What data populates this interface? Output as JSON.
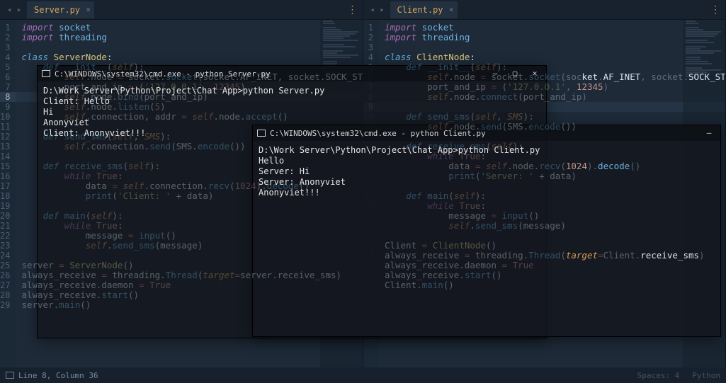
{
  "left": {
    "tab": "Server.py",
    "lines": [
      {
        "n": 1,
        "html": "<span class='kw'>import</span> <span class='fn'>socket</span>"
      },
      {
        "n": 2,
        "html": "<span class='kw'>import</span> <span class='fn'>threading</span>"
      },
      {
        "n": 3,
        "html": ""
      },
      {
        "n": 4,
        "html": "<span class='kw2'>class</span> <span class='cls'>ServerNode</span>:"
      },
      {
        "n": 5,
        "html": "    <span class='kw2 dim'>def</span> <span class='fn dim'>__init__</span><span class='dim'>(</span><span class='self dim'>self</span><span class='dim'>):</span>"
      },
      {
        "n": 6,
        "html": "        <span class='self dim'>self</span><span class='dim'>.node </span><span class='op dim'>=</span><span class='dim'> socket.</span><span class='fn dim'>socket</span><span class='dim'>(socket.AF_INET, socket.SOCK_STREA</span>"
      },
      {
        "n": 7,
        "html": "        <span class='dim'>port_and_ip </span><span class='op dim'>=</span><span class='dim'> (</span><span class='str dim'>'127.0.0.1'</span><span class='dim'>, </span><span class='num dim'>12345</span><span class='dim'>)</span>"
      },
      {
        "n": 8,
        "hl": true,
        "html": "        <span class='self dim'>self</span><span class='dim'>.node.</span><span class='fn dim'>bind</span><span class='dim'>(port_and_ip)</span>"
      },
      {
        "n": 9,
        "html": "        <span class='self dim'>self</span><span class='dim'>.node.</span><span class='fn dim'>listen</span><span class='dim'>(</span><span class='num dim'>5</span><span class='dim'>)</span>"
      },
      {
        "n": 10,
        "html": "        <span class='self dim'>self</span><span class='dim'>.connection, addr </span><span class='op dim'>=</span><span class='dim'> </span><span class='self dim'>self</span><span class='dim'>.node.</span><span class='fn dim'>accept</span><span class='dim'>()</span>"
      },
      {
        "n": 11,
        "html": ""
      },
      {
        "n": 12,
        "html": "    <span class='kw2 dim'>def</span> <span class='fn dim'>send_sms</span><span class='dim'>(</span><span class='self dim'>self</span><span class='dim'>, </span><span class='param dim'>SMS</span><span class='dim'>):</span>"
      },
      {
        "n": 13,
        "html": "        <span class='self dim'>self</span><span class='dim'>.connection.</span><span class='fn dim'>send</span><span class='dim'>(SMS.</span><span class='fn dim'>encode</span><span class='dim'>())</span>"
      },
      {
        "n": 14,
        "html": ""
      },
      {
        "n": 15,
        "html": "    <span class='kw2 dim'>def</span> <span class='fn dim'>receive_sms</span><span class='dim'>(</span><span class='self dim'>self</span><span class='dim'>):</span>"
      },
      {
        "n": 16,
        "html": "        <span class='kw dim'>while</span> <span class='num dim'>True</span><span class='dim'>:</span>"
      },
      {
        "n": 17,
        "html": "            <span class='dim'>data </span><span class='op dim'>=</span><span class='dim'> </span><span class='self dim'>self</span><span class='dim'>.connection.</span><span class='fn dim'>recv</span><span class='dim'>(</span><span class='num dim'>1024</span><span class='dim'>).</span><span class='fn dim'>decode</span><span class='dim'>()</span>"
      },
      {
        "n": 18,
        "html": "            <span class='fn dim'>print</span><span class='dim'>(</span><span class='str dim'>'Client: '</span><span class='dim'> + data)</span>"
      },
      {
        "n": 19,
        "html": ""
      },
      {
        "n": 20,
        "html": "    <span class='kw2 dim'>def</span> <span class='fn dim'>main</span><span class='dim'>(</span><span class='self dim'>self</span><span class='dim'>):</span>"
      },
      {
        "n": 21,
        "html": "        <span class='kw dim'>while</span> <span class='num dim'>True</span><span class='dim'>:</span>"
      },
      {
        "n": 22,
        "html": "            <span class='dim'>message </span><span class='op dim'>=</span><span class='dim'> </span><span class='fn dim'>input</span><span class='dim'>()</span>"
      },
      {
        "n": 23,
        "html": "            <span class='self dim'>self</span><span class='dim'>.</span><span class='fn dim'>send_sms</span><span class='dim'>(message)</span>"
      },
      {
        "n": 24,
        "html": ""
      },
      {
        "n": 25,
        "html": "<span class='dim'>server </span><span class='op dim'>=</span><span class='dim'> </span><span class='cls dim'>ServerNode</span><span class='dim'>()</span>"
      },
      {
        "n": 26,
        "html": "<span class='dim'>always_receive </span><span class='op dim'>=</span><span class='dim'> threading.</span><span class='fn dim'>Thread</span><span class='dim'>(</span><span class='param dim'>target</span><span class='op dim'>=</span><span class='dim'>server.receive_sms)</span>"
      },
      {
        "n": 27,
        "html": "<span class='dim'>always_receive.daemon </span><span class='op dim'>=</span><span class='dim'> </span><span class='num dim'>True</span>"
      },
      {
        "n": 28,
        "html": "<span class='dim'>always_receive.</span><span class='fn dim'>start</span><span class='dim'>()</span>"
      },
      {
        "n": 29,
        "html": "<span class='dim'>server.</span><span class='fn dim'>main</span><span class='dim'>()</span>"
      }
    ]
  },
  "right": {
    "tab": "Client.py",
    "lines": [
      {
        "n": 1,
        "html": "<span class='kw'>import</span> <span class='fn'>socket</span>"
      },
      {
        "n": 2,
        "html": "<span class='kw'>import</span> <span class='fn'>threading</span>"
      },
      {
        "n": 3,
        "html": ""
      },
      {
        "n": 4,
        "html": "<span class='kw2'>class</span> <span class='cls'>ClientNode</span>:"
      },
      {
        "n": 5,
        "html": "    <span class='kw2 dim'>def</span> <span class='fn dim'>__init__</span><span class='dim'>(</span><span class='self dim'>self</span><span class='dim'>):</span>"
      },
      {
        "n": 6,
        "html": "        <span class='self dim'>self</span><span class='dim'>.node </span><span class='op dim'>=</span><span class='dim'> socket.</span><span class='fn dim'>socket</span><span class='dim'>(soc</span>ket<span class='dim'>.</span>AF_INET<span class='dim'>, socket.</span>SOCK_STREA"
      },
      {
        "n": 7,
        "html": "        <span class='dim'>port_and_ip </span><span class='op dim'>=</span><span class='dim'> (</span><span class='str dim'>'127.0.0.1'</span><span class='dim'>, </span><span class='num'>12345</span><span class='dim'>)</span>"
      },
      {
        "n": 8,
        "html": "        <span class='self dim'>self</span><span class='dim'>.node.</span><span class='fn dim'>connect</span><span class='dim'>(port_and_ip)</span>"
      },
      {
        "n": 9,
        "hl": true,
        "html": ""
      },
      {
        "n": 10,
        "html": "    <span class='kw2 dim'>def</span> <span class='fn dim'>send_sms</span><span class='dim'>(</span><span class='self dim'>self</span><span class='dim'>, </span><span class='param dim'>SMS</span><span class='dim'>):</span>"
      },
      {
        "n": 11,
        "html": "        <span class='self dim'>self</span><span class='dim'>.node.</span><span class='fn dim'>send</span><span class='dim'>(SMS.</span><span class='fn dim'>encode</span><span class='dim'>())</span>"
      },
      {
        "n": 12,
        "html": ""
      },
      {
        "n": 13,
        "html": "    <span class='kw2 dim'>def</span> <span class='fn dim'>receive_sms</span><span class='dim'>(</span><span class='self dim'>self</span><span class='dim'>):</span>"
      },
      {
        "n": 14,
        "html": "        <span class='kw dim'>while</span> <span class='num dim'>True</span><span class='dim'>:</span>"
      },
      {
        "n": 15,
        "html": "            <span class='dim'>data </span><span class='op dim'>=</span><span class='dim'> </span><span class='self dim'>self</span><span class='dim'>.node.</span><span class='fn dim'>recv</span><span class='dim'>(</span><span class='num'>1024</span><span class='dim'>).</span><span class='fn'>decode</span><span class='dim'>()</span>"
      },
      {
        "n": 16,
        "html": "            <span class='fn dim'>print</span><span class='dim'>(</span><span class='str dim'>'Server: '</span><span class='dim'> + data)</span>"
      },
      {
        "n": 17,
        "html": ""
      },
      {
        "n": 18,
        "html": "    <span class='kw2 dim'>def</span> <span class='fn dim'>main</span><span class='dim'>(</span><span class='self dim'>self</span><span class='dim'>):</span>"
      },
      {
        "n": 19,
        "html": "        <span class='kw dim'>while</span> <span class='num dim'>True</span><span class='dim'>:</span>"
      },
      {
        "n": 20,
        "html": "            <span class='dim'>message </span><span class='op dim'>=</span><span class='dim'> </span><span class='fn dim'>input</span><span class='dim'>()</span>"
      },
      {
        "n": 21,
        "html": "            <span class='self dim'>self</span><span class='dim'>.</span><span class='fn dim'>send_sms</span><span class='dim'>(message)</span>"
      },
      {
        "n": 22,
        "html": ""
      },
      {
        "n": 23,
        "html": "<span class='dim'>Client </span><span class='op dim'>=</span><span class='dim'> </span><span class='cls dim'>ClientNode</span><span class='dim'>()</span>"
      },
      {
        "n": 24,
        "html": "<span class='dim'>always_receive </span><span class='op dim'>=</span><span class='dim'> threading.</span><span class='fn dim'>Thread</span><span class='dim'>(</span><span class='param'>target</span><span class='op dim'>=</span><span class='dim'>Client.</span>receive_sms<span class='dim'>)</span>"
      },
      {
        "n": 25,
        "html": "<span class='dim'>always_receive.daemon </span><span class='op dim'>=</span><span class='dim'> </span><span class='num dim'>True</span>"
      },
      {
        "n": 26,
        "html": "<span class='dim'>always_receive.</span><span class='fn dim'>start</span><span class='dim'>()</span>"
      },
      {
        "n": 27,
        "html": "<span class='dim'>Client.</span><span class='fn dim'>main</span><span class='dim'>()</span>"
      }
    ]
  },
  "cmd1": {
    "title": "C:\\WINDOWS\\system32\\cmd.exe - python  Server.py",
    "body": "D:\\Work Server\\Python\\Project\\Chat App>python Server.py\nClient: Hello\nHi\nAnonyviet\nClient: Anonyviet!!!"
  },
  "cmd2": {
    "title": "C:\\WINDOWS\\system32\\cmd.exe - python  Client.py",
    "body": "D:\\Work Server\\Python\\Project\\Chat App>python Client.py\nHello\nServer: Hi\nServer: Anonyviet\nAnonyviet!!!"
  },
  "status": {
    "left": "Line 8, Column 36",
    "right1": "Spaces: 4",
    "right2": "Python"
  }
}
